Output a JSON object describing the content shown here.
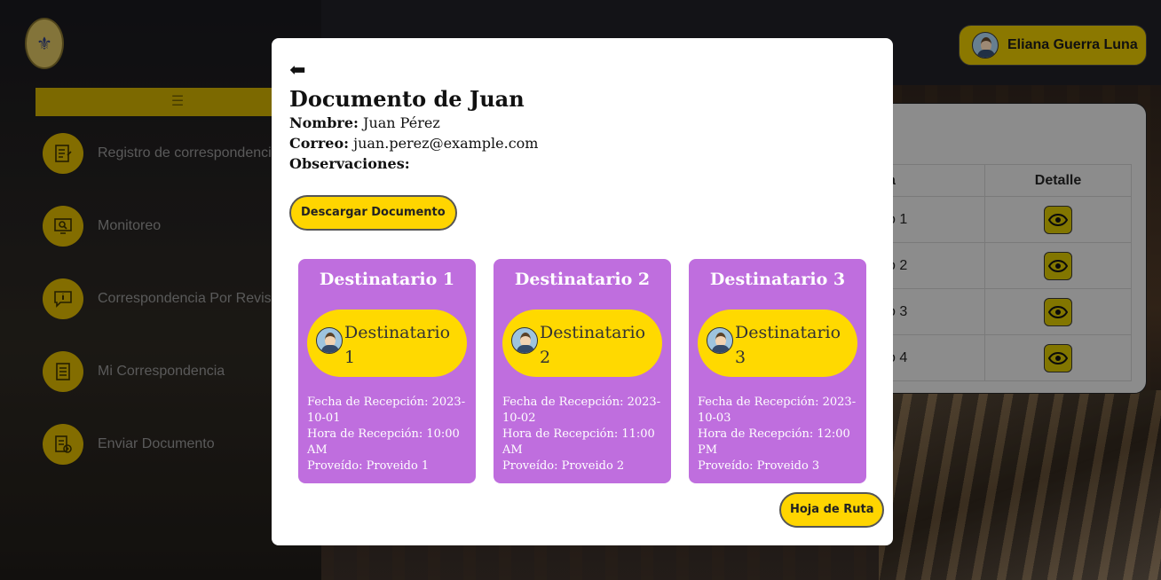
{
  "header": {
    "user_name": "Eliana Guerra Luna",
    "menu_toggle": "☰"
  },
  "sidebar": {
    "items": [
      {
        "label": "Registro de correspondencia",
        "icon": "checklist-icon"
      },
      {
        "label": "Monitoreo",
        "icon": "monitor-search-icon"
      },
      {
        "label": "Correspondencia Por Revisar",
        "icon": "chat-info-icon"
      },
      {
        "label": "Mi Correspondencia",
        "icon": "document-list-icon"
      },
      {
        "label": "Enviar Documento",
        "icon": "document-send-icon"
      }
    ]
  },
  "background_table": {
    "headers": [
      "a",
      "Detalle"
    ],
    "rows": [
      {
        "c1": "o 1"
      },
      {
        "c1": "o 2"
      },
      {
        "c1": "o 3"
      },
      {
        "c1": "o 4"
      }
    ]
  },
  "modal": {
    "back_symbol": "⬅",
    "title": "Documento de Juan",
    "name_label": "Nombre:",
    "name_value": "Juan Pérez",
    "email_label": "Correo:",
    "email_value": "juan.perez@example.com",
    "obs_label": "Observaciones:",
    "obs_value": "",
    "download_label": "Descargar Documento",
    "route_label": "Hoja de Ruta",
    "cards": [
      {
        "title": "Destinatario 1",
        "pill": "Destinatario 1",
        "fecha": "Fecha de Recepción: 2023-10-01",
        "hora": "Hora de Recepción: 10:00 AM",
        "proveido": "Proveído: Proveido 1"
      },
      {
        "title": "Destinatario 2",
        "pill": "Destinatario 2",
        "fecha": "Fecha de Recepción: 2023-10-02",
        "hora": "Hora de Recepción: 11:00 AM",
        "proveido": "Proveído: Proveido 2"
      },
      {
        "title": "Destinatario 3",
        "pill": "Destinatario 3",
        "fecha": "Fecha de Recepción: 2023-10-03",
        "hora": "Hora de Recepción: 12:00 PM",
        "proveido": "Proveído: Proveido 3"
      }
    ]
  }
}
